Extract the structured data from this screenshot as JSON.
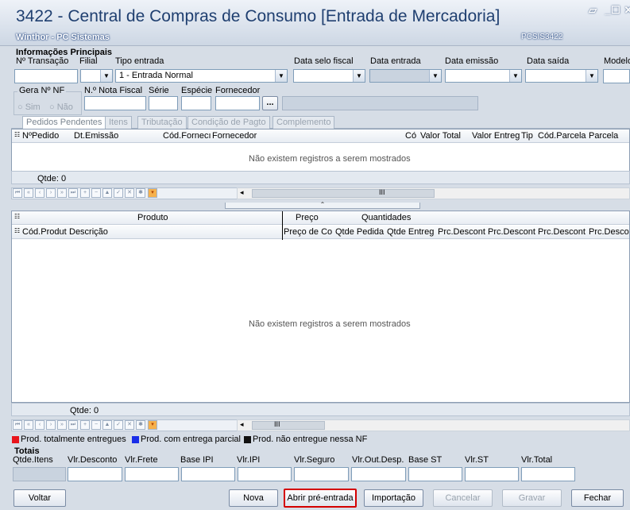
{
  "window": {
    "title": "3422 - Central de Compras de Consumo [Entrada de Mercadoria]",
    "subtitle": "Winthor - PC Sistemas",
    "code": "PCSIS3422",
    "minimize": "▾",
    "restore": "_",
    "maximize": "☐",
    "close": "✕"
  },
  "info": {
    "section_title": "Informações Principais",
    "labels": {
      "transacao": "Nº Transação",
      "filial": "Filial",
      "tipo_entrada": "Tipo entrada",
      "data_selo": "Data selo fiscal",
      "data_entrada": "Data entrada",
      "data_emissao": "Data emissão",
      "data_saida": "Data saída",
      "modelo": "Modelo",
      "gera_nf": "Gera Nº NF",
      "nota_fiscal": "N.º Nota Fiscal",
      "serie": "Série",
      "especie": "Espécie",
      "fornecedor": "Fornecedor"
    },
    "tipo_entrada_value": "1 - Entrada Normal",
    "radio_sim": "Sim",
    "radio_nao": "Não",
    "ellipsis": "..."
  },
  "tabs": [
    "Pedidos Pendentes",
    "Itens",
    "Tributação",
    "Condição de Pagto",
    "Complemento"
  ],
  "orders_grid": {
    "columns": [
      "NºPedido",
      "Dt.Emissão",
      "Cód.Fornecı",
      "Fornecedor",
      "Có",
      "Valor Total",
      "Valor Entreg",
      "Tip",
      "Cód.Parcela",
      "Parcela"
    ],
    "empty_text": "Não existem registros a serem mostrados",
    "count_label": "Qtde: 0",
    "scroll_mid": "III"
  },
  "items_grid": {
    "band_produto": "Produto",
    "band_preco": "Preço",
    "band_quantidades": "Quantidades",
    "columns": [
      "Cód.Produt",
      "Descrição",
      "Preço de Co",
      "Qtde Pedida",
      "Qtde Entreg",
      "Prc.Descont",
      "Prc.Descont",
      "Prc.Descont",
      "Prc.Descon"
    ],
    "empty_text": "Não existem registros a serem mostrados",
    "count_label": "Qtde: 0",
    "scroll_mid": "III"
  },
  "legend": [
    {
      "label": "Prod. totalmente entregues",
      "color": "#e8141b"
    },
    {
      "label": "Prod. com entrega parcial",
      "color": "#1a2ee8"
    },
    {
      "label": "Prod. não entregue nessa NF",
      "color": "#111111"
    }
  ],
  "totals": {
    "title": "Totais",
    "labels": [
      "Qtde.Itens",
      "Vlr.Desconto",
      "Vlr.Frete",
      "Base IPI",
      "Vlr.IPI",
      "Vlr.Seguro",
      "Vlr.Out.Desp.",
      "Base ST",
      "Vlr.ST",
      "Vlr.Total"
    ]
  },
  "buttons": {
    "voltar": "Voltar",
    "nova": "Nova",
    "abrir": "Abrir pré-entrada",
    "importacao": "Importação",
    "cancelar": "Cancelar",
    "gravar": "Gravar",
    "fechar": "Fechar"
  },
  "colors": {
    "highlight_border": "#d40000",
    "title_text": "#1f3f70"
  }
}
